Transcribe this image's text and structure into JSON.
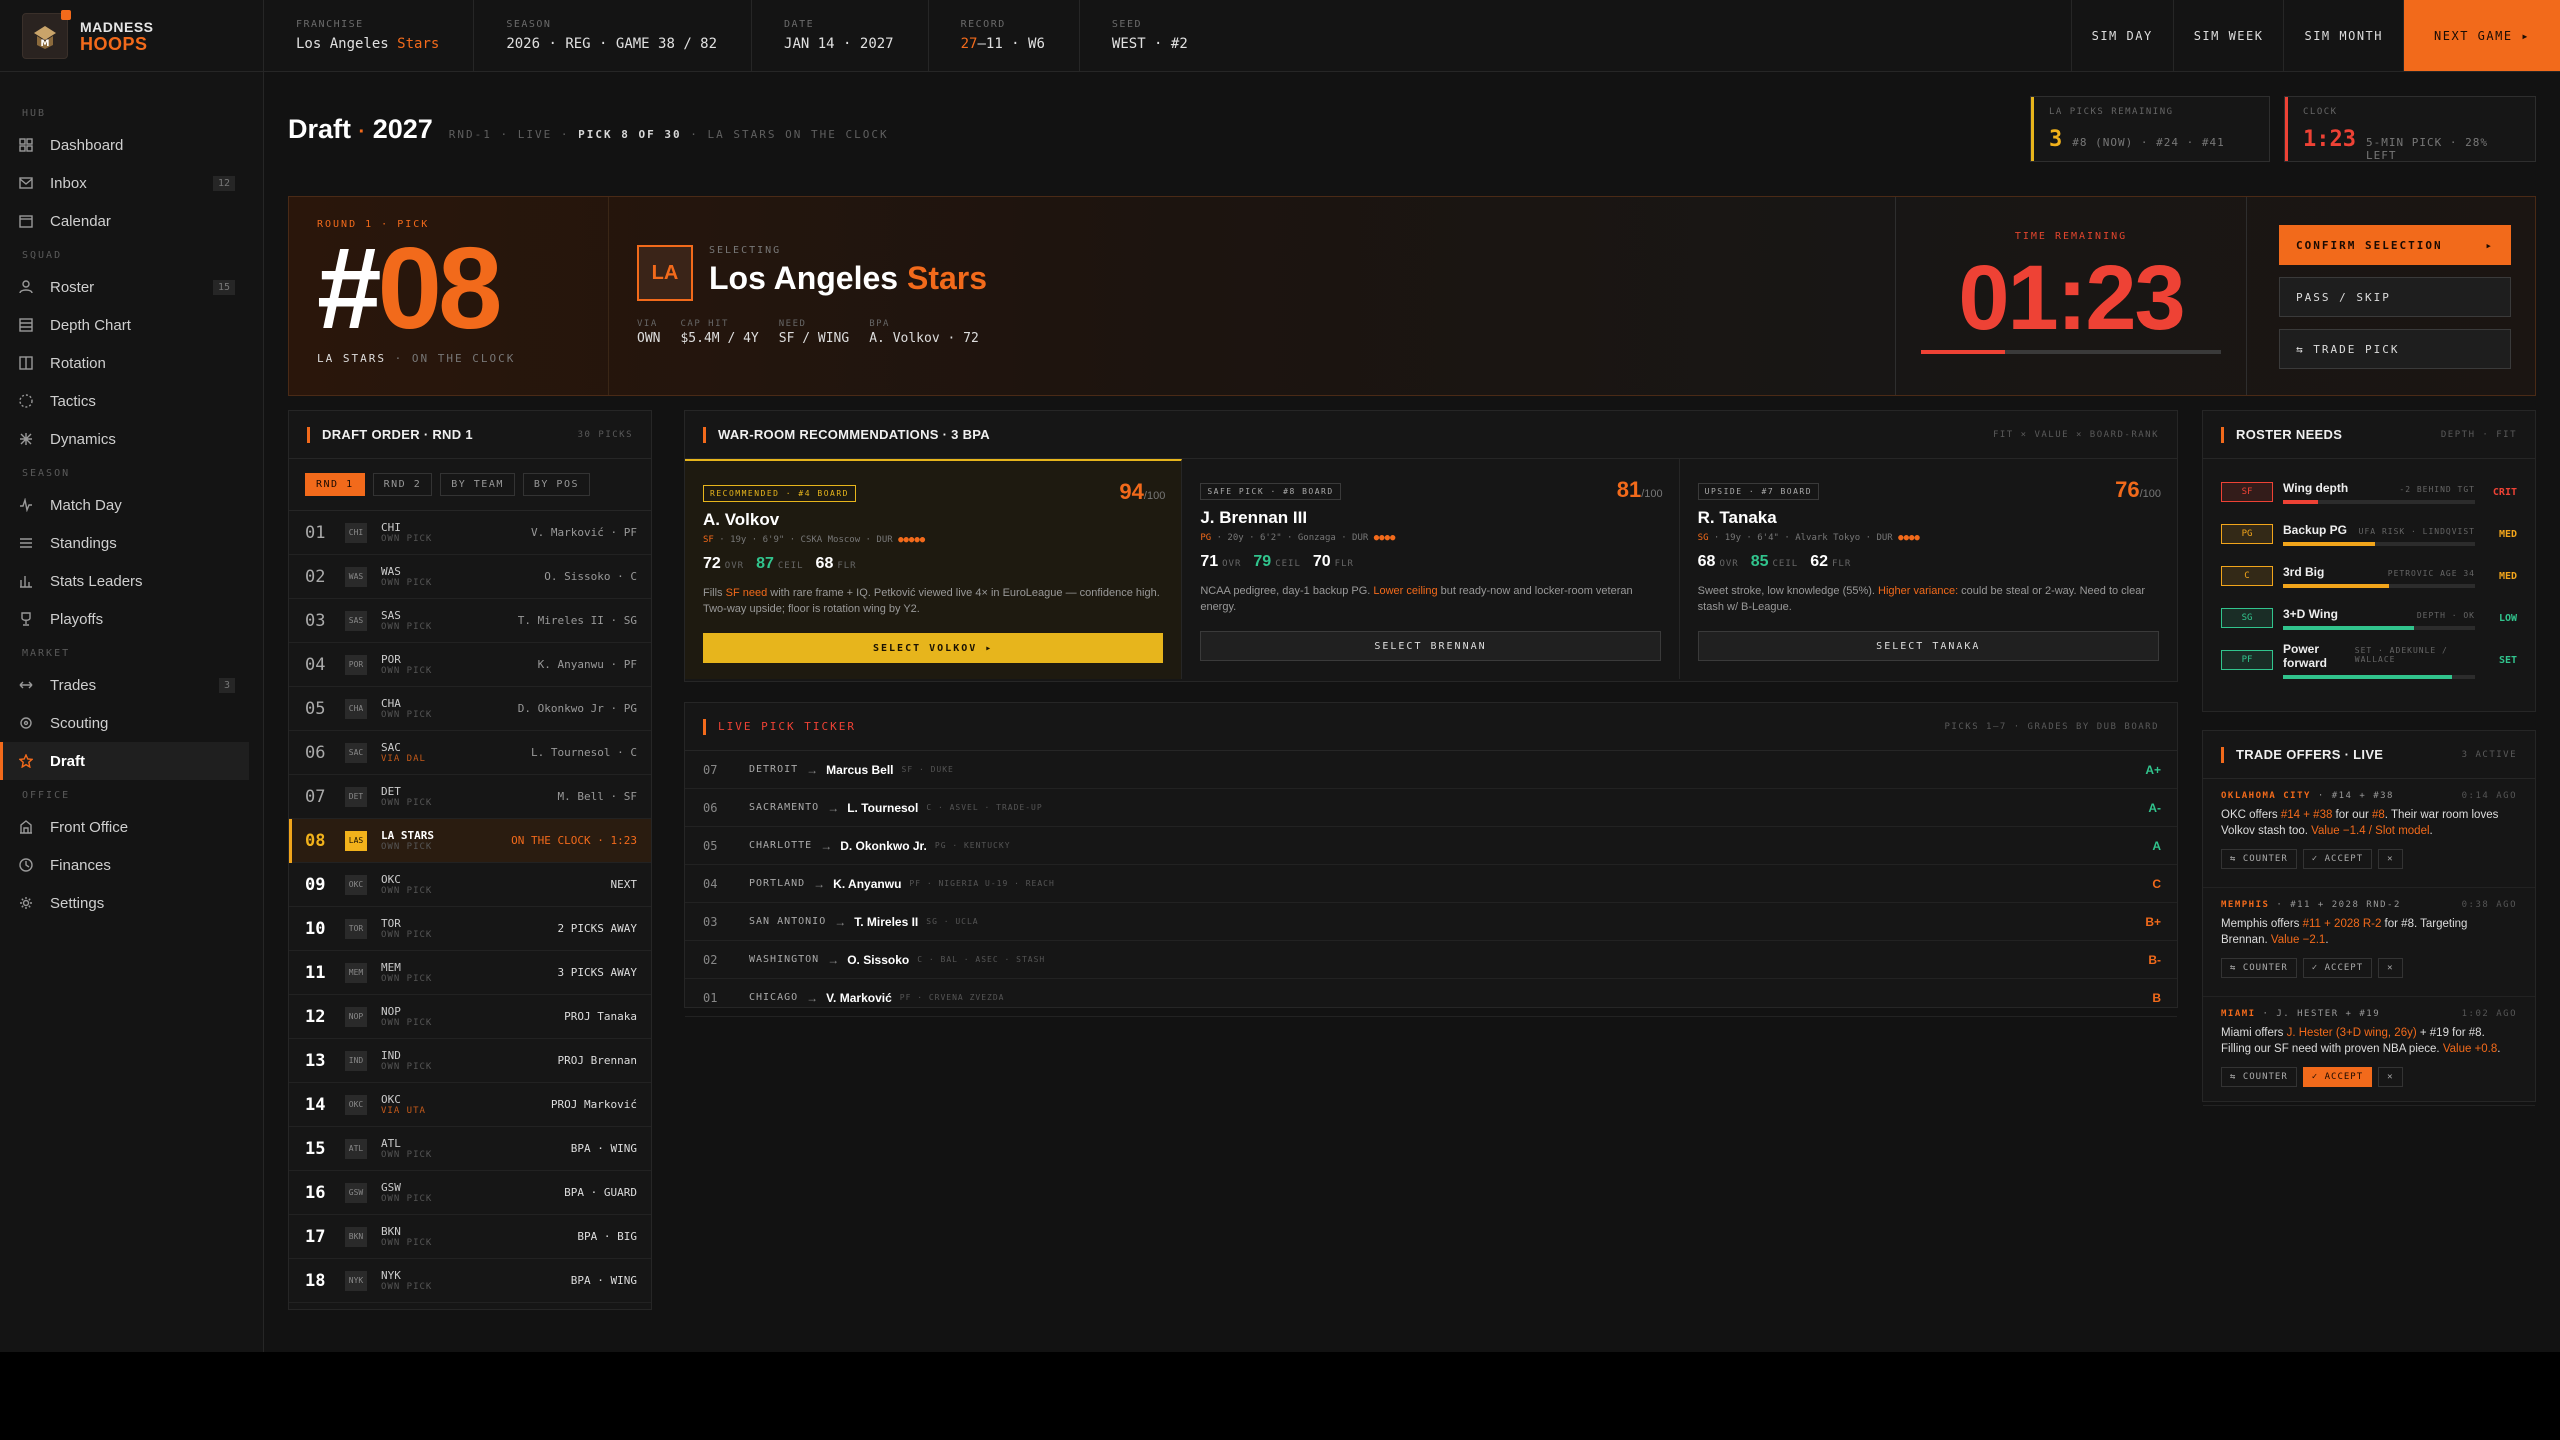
{
  "brand": {
    "line1": "MADNESS",
    "line2": "HOOPS"
  },
  "topbar": {
    "stats": [
      {
        "label": "FRANCHISE",
        "value_a": "Los Angeles ",
        "value_b": "Stars"
      },
      {
        "label": "SEASON",
        "value_a": "2026 · REG · GAME 38 / 82",
        "value_b": ""
      },
      {
        "label": "DATE",
        "value_a": "JAN 14 · 2027",
        "value_b": ""
      },
      {
        "label": "RECORD",
        "value_a": "",
        "value_b": "27",
        "value_c": "–11 · W6"
      },
      {
        "label": "SEED",
        "value_a": "WEST · #2",
        "value_b": ""
      }
    ],
    "buttons": [
      "SIM DAY",
      "SIM WEEK",
      "SIM MONTH",
      "NEXT GAME ▸"
    ]
  },
  "sidebar": {
    "sections": [
      {
        "title": "HUB",
        "items": [
          {
            "label": "Dashboard",
            "icon": "grid-icon"
          },
          {
            "label": "Inbox",
            "icon": "mail-icon",
            "badge": "12"
          },
          {
            "label": "Calendar",
            "icon": "calendar-icon"
          }
        ]
      },
      {
        "title": "SQUAD",
        "items": [
          {
            "label": "Roster",
            "icon": "user-icon",
            "badge": "15"
          },
          {
            "label": "Depth Chart",
            "icon": "layers-icon"
          },
          {
            "label": "Rotation",
            "icon": "rotation-icon"
          },
          {
            "label": "Tactics",
            "icon": "tactics-icon"
          },
          {
            "label": "Dynamics",
            "icon": "dynamics-icon"
          }
        ]
      },
      {
        "title": "SEASON",
        "items": [
          {
            "label": "Match Day",
            "icon": "pulse-icon"
          },
          {
            "label": "Standings",
            "icon": "list-icon"
          },
          {
            "label": "Stats Leaders",
            "icon": "bar-chart-icon"
          },
          {
            "label": "Playoffs",
            "icon": "trophy-icon"
          }
        ]
      },
      {
        "title": "MARKET",
        "items": [
          {
            "label": "Trades",
            "icon": "swap-icon",
            "badge": "3"
          },
          {
            "label": "Scouting",
            "icon": "scout-icon"
          },
          {
            "label": "Draft",
            "icon": "star-icon",
            "active": true
          }
        ]
      },
      {
        "title": "OFFICE",
        "items": [
          {
            "label": "Front Office",
            "icon": "building-icon"
          },
          {
            "label": "Finances",
            "icon": "finance-icon"
          },
          {
            "label": "Settings",
            "icon": "gear-icon"
          }
        ]
      }
    ]
  },
  "page": {
    "title_a": "Draft",
    "title_dot": "·",
    "title_b": "2027",
    "sub_a": "RND-1 · LIVE · ",
    "sub_b": "PICK 8 OF 30",
    "sub_c": " · LA STARS ON THE CLOCK"
  },
  "header_cards": {
    "picks": {
      "label": "LA PICKS REMAINING",
      "big": "3",
      "small": "#8 (NOW) · #24 · #41"
    },
    "clock": {
      "label": "CLOCK",
      "big": "1:23",
      "small": "5-MIN PICK · 28% LEFT"
    }
  },
  "hero": {
    "round_label": "ROUND 1 · PICK",
    "hash": "#",
    "number": "08",
    "team": "LA STARS",
    "status": " · ON THE CLOCK",
    "tile": "LA",
    "selecting_label": "SELECTING",
    "name_a": "Los Angeles ",
    "name_b": "Stars",
    "tags": [
      {
        "k": "VIA",
        "v": "OWN"
      },
      {
        "k": "CAP HIT",
        "v": "$5.4M / 4Y"
      },
      {
        "k": "NEED",
        "v": "SF / WING",
        "orange": true
      },
      {
        "k": "BPA",
        "v": "A. Volkov · 72"
      }
    ],
    "timer_label": "TIME REMAINING",
    "timer": "01:23",
    "timer_progress": 0.28,
    "actions": [
      "CONFIRM SELECTION",
      "PASS / SKIP",
      "⇆ TRADE PICK"
    ],
    "confirm_arrow": "▸"
  },
  "draft_order": {
    "title": "DRAFT ORDER · RND 1",
    "meta": "30 PICKS",
    "chips": [
      "RND 1",
      "RND 2",
      "BY TEAM",
      "BY POS"
    ],
    "rows": [
      {
        "no": "01",
        "abbr": "CHI",
        "team": "CHI",
        "sub": "OWN PICK",
        "right": "V. Marković · PF"
      },
      {
        "no": "02",
        "abbr": "WAS",
        "team": "WAS",
        "sub": "OWN PICK",
        "right": "O. Sissoko · C"
      },
      {
        "no": "03",
        "abbr": "SAS",
        "team": "SAS",
        "sub": "OWN PICK",
        "right": "T. Mireles II · SG"
      },
      {
        "no": "04",
        "abbr": "POR",
        "team": "POR",
        "sub": "OWN PICK",
        "right": "K. Anyanwu · PF"
      },
      {
        "no": "05",
        "abbr": "CHA",
        "team": "CHA",
        "sub": "OWN PICK",
        "right": "D. Okonkwo Jr · PG"
      },
      {
        "no": "06",
        "abbr": "SAC",
        "team": "SAC",
        "sub": "VIA DAL",
        "right": "L. Tournesol · C",
        "via": true
      },
      {
        "no": "07",
        "abbr": "DET",
        "team": "DET",
        "sub": "OWN PICK",
        "right": "M. Bell · SF"
      },
      {
        "no": "08",
        "abbr": "LAS",
        "team": "LA STARS",
        "sub": "OWN PICK",
        "right": "ON THE CLOCK · 1:23",
        "current": true
      },
      {
        "no": "09",
        "abbr": "OKC",
        "team": "OKC",
        "sub": "OWN PICK",
        "right": "NEXT",
        "future": true
      },
      {
        "no": "10",
        "abbr": "TOR",
        "team": "TOR",
        "sub": "OWN PICK",
        "right": "2 PICKS AWAY",
        "future": true
      },
      {
        "no": "11",
        "abbr": "MEM",
        "team": "MEM",
        "sub": "OWN PICK",
        "right": "3 PICKS AWAY",
        "future": true
      },
      {
        "no": "12",
        "abbr": "NOP",
        "team": "NOP",
        "sub": "OWN PICK",
        "right": "PROJ Tanaka",
        "future": true
      },
      {
        "no": "13",
        "abbr": "IND",
        "team": "IND",
        "sub": "OWN PICK",
        "right": "PROJ Brennan",
        "future": true
      },
      {
        "no": "14",
        "abbr": "OKC",
        "team": "OKC",
        "sub": "VIA UTA",
        "right": "PROJ Marković",
        "future": true,
        "via": true
      },
      {
        "no": "15",
        "abbr": "ATL",
        "team": "ATL",
        "sub": "OWN PICK",
        "right": "BPA · WING",
        "future": true
      },
      {
        "no": "16",
        "abbr": "GSW",
        "team": "GSW",
        "sub": "OWN PICK",
        "right": "BPA · GUARD",
        "future": true
      },
      {
        "no": "17",
        "abbr": "BKN",
        "team": "BKN",
        "sub": "OWN PICK",
        "right": "BPA · BIG",
        "future": true
      },
      {
        "no": "18",
        "abbr": "NYK",
        "team": "NYK",
        "sub": "OWN PICK",
        "right": "BPA · WING",
        "future": true
      }
    ]
  },
  "recs": {
    "title": "WAR-ROOM RECOMMENDATIONS · 3 BPA",
    "meta": "FIT × VALUE × BOARD-RANK",
    "cards": [
      {
        "badge": "RECOMMENDED · #4 BOARD",
        "score": "94",
        "of": "/100",
        "name": "A. Volkov",
        "pos": "SF",
        "meta": " · 19y · 6'9\" · CSKA Moscow · DUR ",
        "meta_stars": "●●●●●",
        "ovr": "72",
        "ceil": "87",
        "flr": "68",
        "desc_a": "Fills ",
        "desc_em": "SF need",
        "desc_b": " with rare frame + IQ. Petković viewed live 4× in EuroLeague — confidence high. Two-way upside; floor is rotation wing by Y2.",
        "button": "SELECT VOLKOV ▸",
        "best": true
      },
      {
        "badge": "SAFE PICK · #8 BOARD",
        "score": "81",
        "of": "/100",
        "name": "J. Brennan III",
        "pos": "PG",
        "meta": " · 20y · 6'2\" · Gonzaga · DUR ",
        "meta_stars": "●●●●",
        "ovr": "71",
        "ceil": "79",
        "flr": "70",
        "desc_a": "NCAA pedigree, day-1 backup PG. ",
        "desc_em": "Lower ceiling",
        "desc_b": " but ready-now and locker-room veteran energy.",
        "button": "SELECT BRENNAN"
      },
      {
        "badge": "UPSIDE · #7 BOARD",
        "score": "76",
        "of": "/100",
        "name": "R. Tanaka",
        "pos": "SG",
        "meta": " · 19y · 6'4\" · Alvark Tokyo · DUR ",
        "meta_stars": "●●●●",
        "ovr": "68",
        "ceil": "85",
        "flr": "62",
        "desc_a": "Sweet stroke, low knowledge (55%). ",
        "desc_em": "Higher variance:",
        "desc_b": " could be steal or 2-way. Need to clear stash w/ B-League.",
        "button": "SELECT TANAKA"
      }
    ],
    "lbl_ovr": "OVR",
    "lbl_ceil": "CEIL",
    "lbl_flr": "FLR"
  },
  "ticker": {
    "title": "LIVE PICK TICKER",
    "meta": "PICKS 1–7 · GRADES BY DUB BOARD",
    "rows": [
      {
        "no": "07",
        "city": "DETROIT",
        "player": "Marcus Bell",
        "meta": "SF · DUKE",
        "grade": "A+",
        "color": "#31c48d"
      },
      {
        "no": "06",
        "city": "SACRAMENTO",
        "player": "L. Tournesol",
        "meta": "C · ASVEL · TRADE-UP",
        "grade": "A-",
        "color": "#31c48d"
      },
      {
        "no": "05",
        "city": "CHARLOTTE",
        "player": "D. Okonkwo Jr.",
        "meta": "PG · KENTUCKY",
        "grade": "A",
        "color": "#31c48d"
      },
      {
        "no": "04",
        "city": "PORTLAND",
        "player": "K. Anyanwu",
        "meta": "PF · NIGERIA U-19 · REACH",
        "grade": "C",
        "color": "#f26a1b"
      },
      {
        "no": "03",
        "city": "SAN ANTONIO",
        "player": "T. Mireles II",
        "meta": "SG · UCLA",
        "grade": "B+",
        "color": "#f26a1b"
      },
      {
        "no": "02",
        "city": "WASHINGTON",
        "player": "O. Sissoko",
        "meta": "C · BAL · ASEC · STASH",
        "grade": "B-",
        "color": "#f26a1b"
      },
      {
        "no": "01",
        "city": "CHICAGO",
        "player": "V. Marković",
        "meta": "PF · CRVENA ZVEZDA",
        "grade": "B",
        "color": "#f26a1b"
      }
    ]
  },
  "needs": {
    "title": "ROSTER NEEDS",
    "meta": "DEPTH · FIT",
    "rows": [
      {
        "pos": "SF",
        "name": "Wing depth",
        "note": "-2 BEHIND TGT",
        "status": "CRIT",
        "level": 0.18,
        "color": "#ee4235"
      },
      {
        "pos": "PG",
        "name": "Backup PG",
        "note": "UFA RISK · LINDQVIST",
        "status": "MED",
        "level": 0.48,
        "color": "#f2a51b"
      },
      {
        "pos": "C",
        "name": "3rd Big",
        "note": "PETROVIC AGE 34",
        "status": "MED",
        "level": 0.55,
        "color": "#f2a51b"
      },
      {
        "pos": "SG",
        "name": "3+D Wing",
        "note": "DEPTH · OK",
        "status": "LOW",
        "level": 0.68,
        "color": "#31c48d"
      },
      {
        "pos": "PF",
        "name": "Power forward",
        "note": "SET · ADEKUNLE / WALLACE",
        "status": "SET",
        "level": 0.88,
        "color": "#31c48d"
      }
    ]
  },
  "offers": {
    "title": "TRADE OFFERS · LIVE",
    "meta": "3 ACTIVE",
    "items": [
      {
        "team": "OKLAHOMA CITY",
        "deal": " · #14 + #38",
        "ago": "0:14 AGO",
        "t1": "OKC offers ",
        "e1": "#14 + #38",
        "t2": " for our ",
        "e2": "#8",
        "t3": ". Their war room loves Volkov stash too. ",
        "e3": "Value −1.4 / Slot model",
        "t4": ".",
        "btns": [
          "⇆ COUNTER",
          "✓ ACCEPT",
          "✕"
        ],
        "on": -1
      },
      {
        "team": "MEMPHIS",
        "deal": " · #11 + 2028 RND-2",
        "ago": "0:38 AGO",
        "t1": "Memphis offers ",
        "e1": "#11 + 2028 R-2",
        "t2": " for #8. Targeting Brennan. ",
        "e2": "Value −2.1",
        "t3": ".",
        "e3": "",
        "t4": "",
        "btns": [
          "⇆ COUNTER",
          "✓ ACCEPT",
          "✕"
        ],
        "on": -1
      },
      {
        "team": "MIAMI",
        "deal": " · J. HESTER + #19",
        "ago": "1:02 AGO",
        "t1": "Miami offers ",
        "e1": "J. Hester (3+D wing, 26y)",
        "t2": " + #19 for #8. Filling our SF need with proven NBA piece. ",
        "e2": "Value +0.8",
        "t3": ".",
        "e3": "",
        "t4": "",
        "btns": [
          "⇆ COUNTER",
          "✓ ACCEPT",
          "✕"
        ],
        "on": 1
      }
    ]
  }
}
